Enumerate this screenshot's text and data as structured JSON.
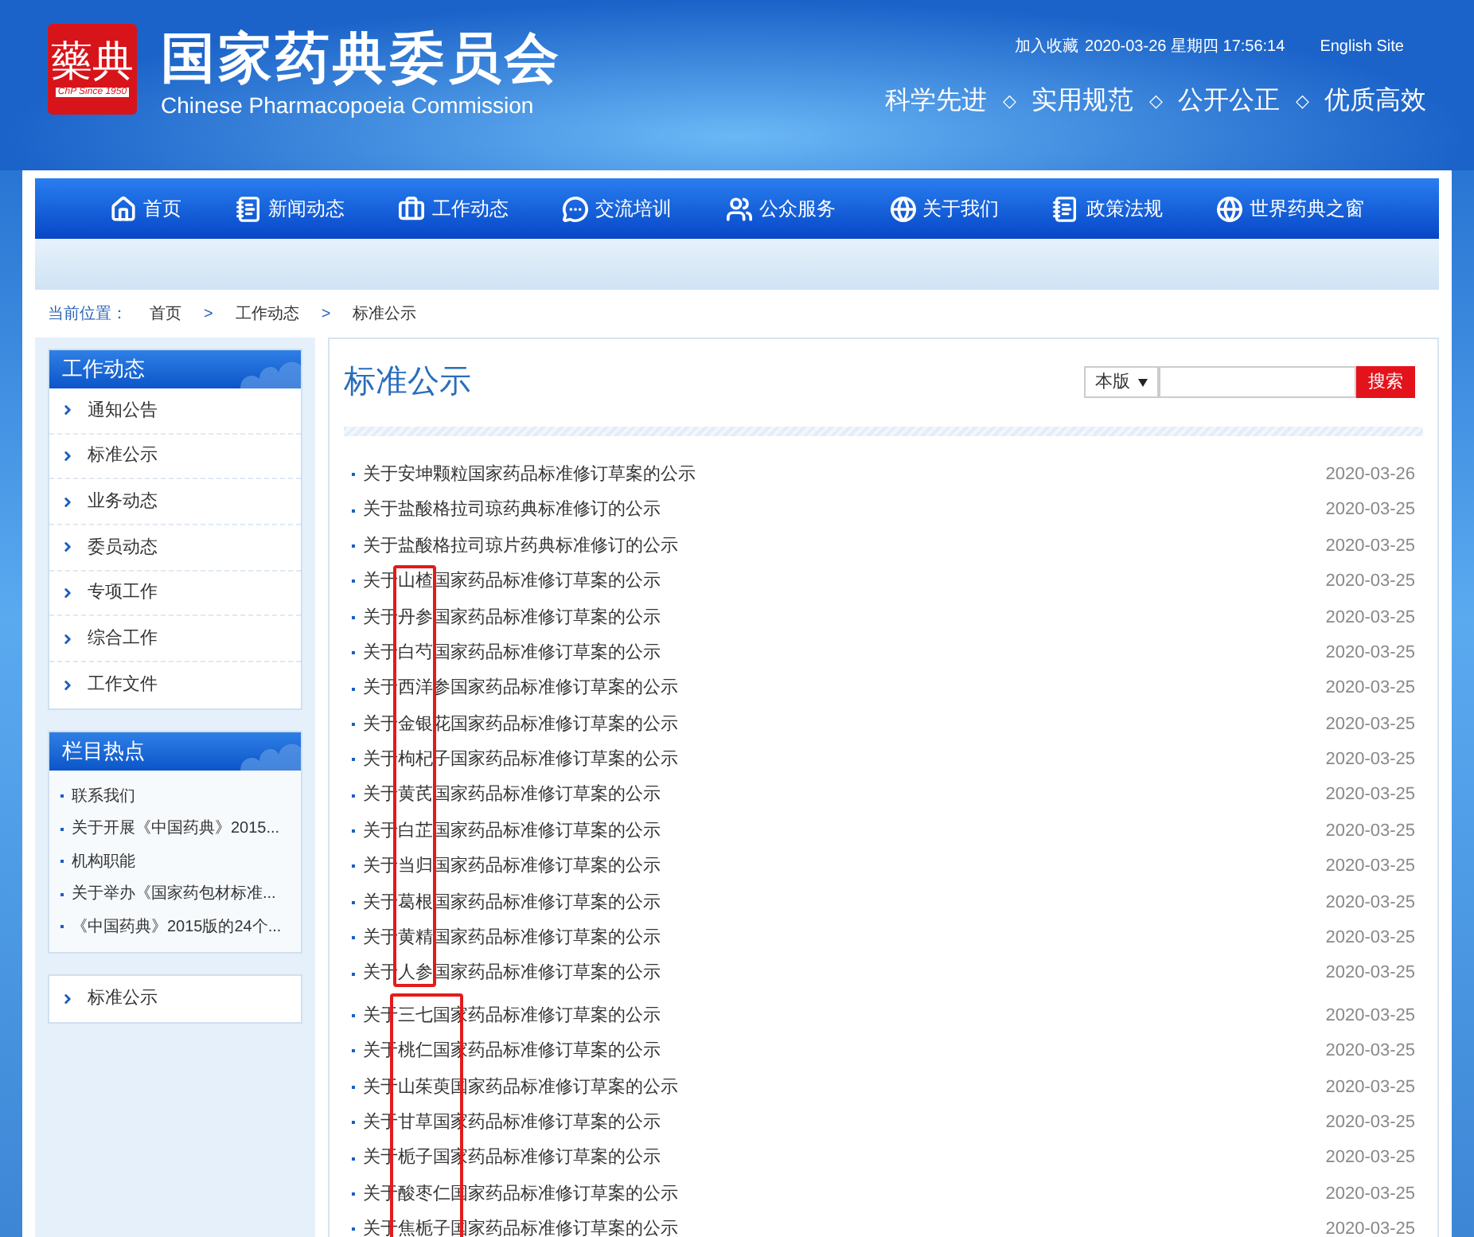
{
  "header": {
    "logo": {
      "mark": "藥典",
      "caption": "ChP Since 1950"
    },
    "title": "国家药典委员会",
    "subtitle": "Chinese Pharmacopoeia Commission",
    "top_links": [
      {
        "kind": "text",
        "label": "加入收藏"
      },
      {
        "kind": "text",
        "label": "2020-03-26 星期四 17:56:14"
      },
      {
        "kind": "link",
        "label": "English Site"
      }
    ],
    "slogans": [
      "科学先进",
      "实用规范",
      "公开公正",
      "优质高效"
    ],
    "separator": "◇"
  },
  "nav": [
    {
      "kind": "home",
      "label": "首页"
    },
    {
      "kind": "list",
      "label": "新闻动态"
    },
    {
      "kind": "briefcase",
      "label": "工作动态"
    },
    {
      "kind": "chat",
      "label": "交流培训"
    },
    {
      "kind": "users",
      "label": "公众服务"
    },
    {
      "kind": "globe",
      "label": "关于我们"
    },
    {
      "kind": "list",
      "label": "政策法规"
    },
    {
      "kind": "globe",
      "label": "世界药典之窗"
    }
  ],
  "breadcrumb": {
    "label": "当前位置：",
    "items": [
      "首页",
      "工作动态",
      "标准公示"
    ],
    "separator": ">"
  },
  "sidebar": [
    {
      "kind": "menu",
      "title": "工作动态",
      "items": [
        "通知公告",
        "标准公示",
        "业务动态",
        "委员动态",
        "专项工作",
        "综合工作",
        "工作文件"
      ]
    },
    {
      "kind": "bullets",
      "title": "栏目热点",
      "items": [
        "联系我们",
        "关于开展《中国药典》2015...",
        "机构职能",
        "关于举办《国家药包材标准...",
        "《中国药典》2015版的24个..."
      ]
    },
    {
      "kind": "menu",
      "items": [
        "标准公示"
      ]
    }
  ],
  "main": {
    "title": "标准公示",
    "search": {
      "scope": "本版",
      "button": "搜索"
    },
    "groups": [
      {
        "rows": [
          {
            "title": "关于安坤颗粒国家药品标准修订草案的公示",
            "date": "2020-03-26"
          },
          {
            "title": "关于盐酸格拉司琼药典标准修订的公示",
            "date": "2020-03-25"
          },
          {
            "title": "关于盐酸格拉司琼片药典标准修订的公示",
            "date": "2020-03-25"
          }
        ]
      },
      {
        "kind": "narrow-frame",
        "rows": [
          {
            "title": "关于山楂国家药品标准修订草案的公示",
            "date": "2020-03-25"
          },
          {
            "title": "关于丹参国家药品标准修订草案的公示",
            "date": "2020-03-25"
          },
          {
            "title": "关于白芍国家药品标准修订草案的公示",
            "date": "2020-03-25"
          },
          {
            "title": "关于西洋参国家药品标准修订草案的公示",
            "date": "2020-03-25"
          },
          {
            "title": "关于金银花国家药品标准修订草案的公示",
            "date": "2020-03-25"
          },
          {
            "title": "关于枸杞子国家药品标准修订草案的公示",
            "date": "2020-03-25"
          },
          {
            "title": "关于黄芪国家药品标准修订草案的公示",
            "date": "2020-03-25"
          },
          {
            "title": "关于白芷国家药品标准修订草案的公示",
            "date": "2020-03-25"
          },
          {
            "title": "关于当归国家药品标准修订草案的公示",
            "date": "2020-03-25"
          },
          {
            "title": "关于葛根国家药品标准修订草案的公示",
            "date": "2020-03-25"
          },
          {
            "title": "关于黄精国家药品标准修订草案的公示",
            "date": "2020-03-25"
          },
          {
            "title": "关于人参国家药品标准修订草案的公示",
            "date": "2020-03-25"
          }
        ]
      },
      {
        "kind": "wide-frame",
        "rows": [
          {
            "title": "关于三七国家药品标准修订草案的公示",
            "date": "2020-03-25"
          },
          {
            "title": "关于桃仁国家药品标准修订草案的公示",
            "date": "2020-03-25"
          },
          {
            "title": "关于山茱萸国家药品标准修订草案的公示",
            "date": "2020-03-25"
          },
          {
            "title": "关于甘草国家药品标准修订草案的公示",
            "date": "2020-03-25"
          },
          {
            "title": "关于栀子国家药品标准修订草案的公示",
            "date": "2020-03-25"
          },
          {
            "title": "关于酸枣仁国家药品标准修订草案的公示",
            "date": "2020-03-25"
          },
          {
            "title": "关于焦栀子国家药品标准修订草案的公示",
            "date": "2020-03-25"
          }
        ]
      }
    ]
  }
}
